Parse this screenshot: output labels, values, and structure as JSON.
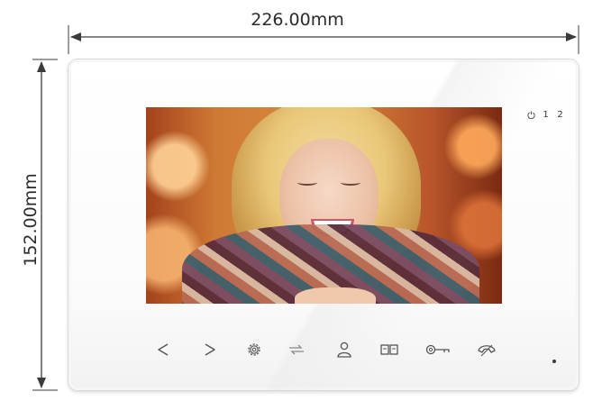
{
  "dimensions": {
    "width_label": "226.00mm",
    "height_label": "152.00mm"
  },
  "indicators": {
    "line_1": "1",
    "line_2": "2"
  },
  "buttons": [
    {
      "icon": "left-arrow-icon"
    },
    {
      "icon": "right-arrow-icon"
    },
    {
      "icon": "settings-gear-icon"
    },
    {
      "icon": "transfer-icon"
    },
    {
      "icon": "user-monitor-icon"
    },
    {
      "icon": "intercom-icon"
    },
    {
      "icon": "unlock-key-icon"
    },
    {
      "icon": "phone-handset-icon"
    }
  ],
  "colors": {
    "frame": "#ffffff",
    "icon": "#555555",
    "dimension_line": "#3a3a3a"
  }
}
